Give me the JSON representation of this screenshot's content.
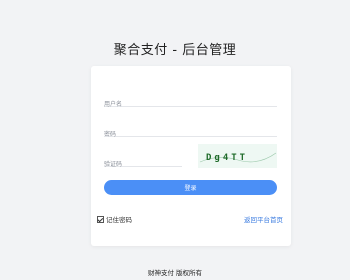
{
  "page": {
    "title": "聚合支付 - 后台管理"
  },
  "form": {
    "username_placeholder": "用户名",
    "password_placeholder": "密码",
    "captcha_placeholder": "验证码",
    "captcha_text": "Dg4TT",
    "login_label": "登录",
    "remember_label": "记住密码",
    "remember_checked": true,
    "back_link_label": "返回平台首页"
  },
  "footer": {
    "text": "财神支付 版权所有"
  },
  "colors": {
    "background": "#f2f3f5",
    "card": "#ffffff",
    "accent": "#4b8ff6",
    "link": "#3a7be0",
    "captcha_bg": "#eef8f3",
    "captcha_text": "#1f6b2a"
  }
}
